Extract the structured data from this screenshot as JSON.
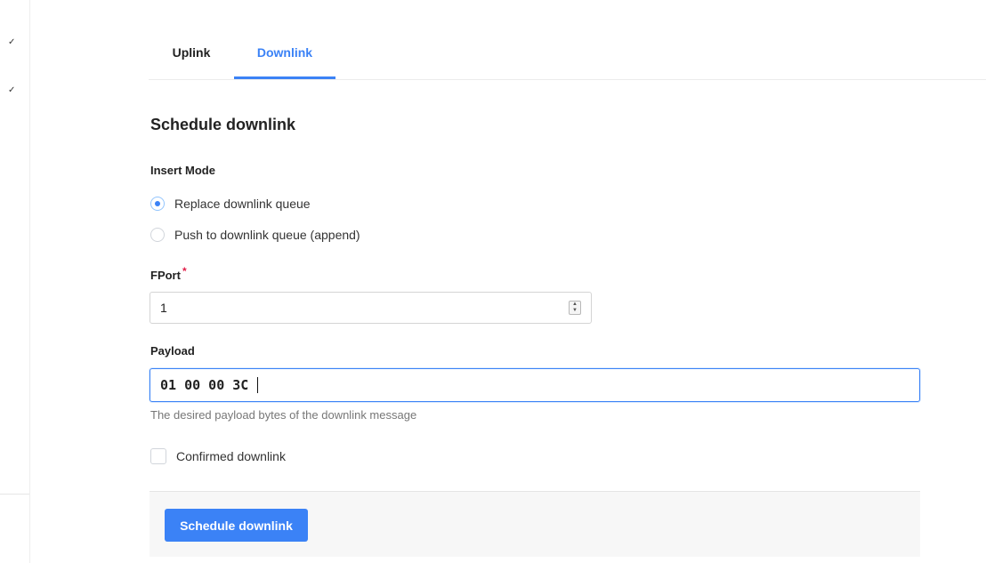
{
  "tabs": [
    {
      "label": "Uplink"
    },
    {
      "label": "Downlink"
    }
  ],
  "section_title": "Schedule downlink",
  "insert_mode": {
    "label": "Insert Mode",
    "options": [
      {
        "label": "Replace downlink queue",
        "checked": true
      },
      {
        "label": "Push to downlink queue (append)",
        "checked": false
      }
    ]
  },
  "fport": {
    "label": "FPort",
    "required_mark": "*",
    "value": "1"
  },
  "payload": {
    "label": "Payload",
    "value": "01 00 00 3C",
    "help": "The desired payload bytes of the downlink message"
  },
  "confirmed": {
    "label": "Confirmed downlink",
    "checked": false
  },
  "submit_label": "Schedule downlink",
  "colors": {
    "accent": "#3b82f6",
    "required": "#e11d48"
  },
  "icons": [
    "check-icon",
    "stepper-icon"
  ]
}
